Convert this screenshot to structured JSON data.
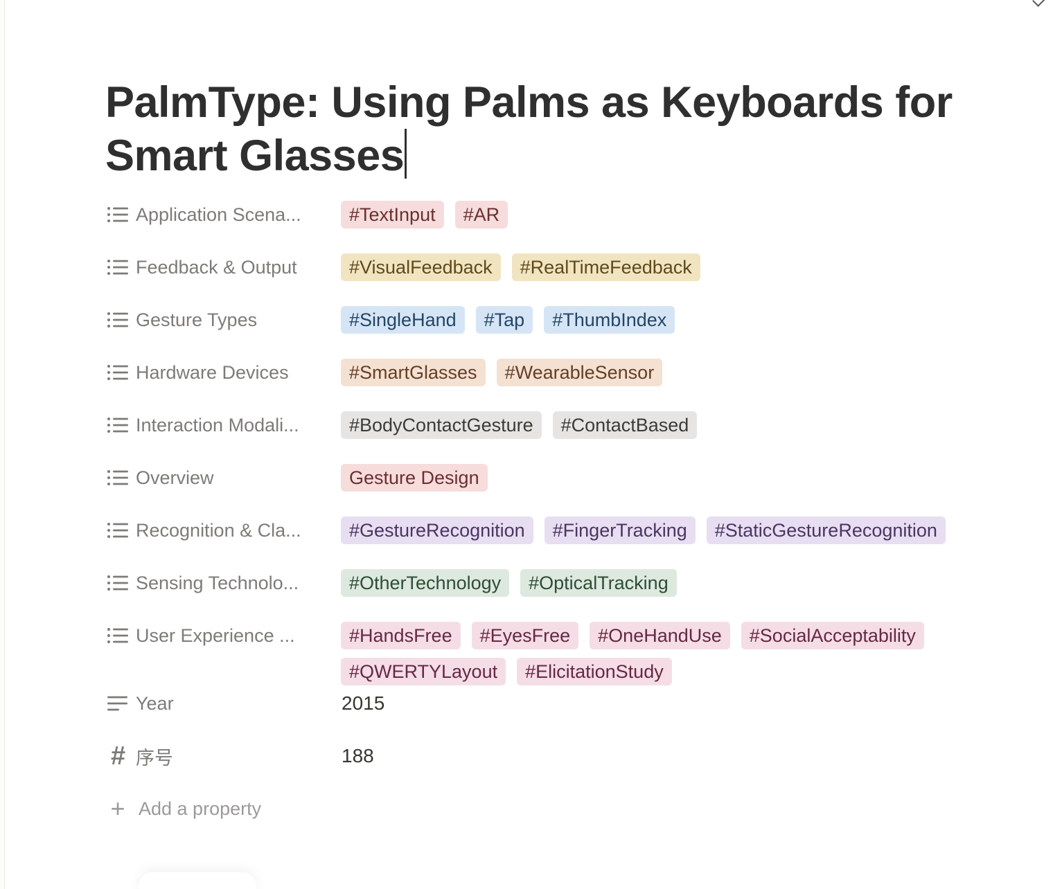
{
  "page": {
    "title": "PalmType: Using Palms as Keyboards for Smart Glasses"
  },
  "properties": [
    {
      "label": "Application Scena...",
      "icon": "list-icon",
      "tags": [
        "#TextInput",
        "#AR"
      ],
      "color": {
        "bg": "#f6dcdc",
        "fg": "#6b2f2f"
      }
    },
    {
      "label": "Feedback & Output",
      "icon": "list-icon",
      "tags": [
        "#VisualFeedback",
        "#RealTimeFeedback"
      ],
      "color": {
        "bg": "#f1e4c1",
        "fg": "#5e4a1c"
      }
    },
    {
      "label": "Gesture Types",
      "icon": "list-icon",
      "tags": [
        "#SingleHand",
        "#Tap",
        "#ThumbIndex"
      ],
      "color": {
        "bg": "#d6e5f5",
        "fg": "#244566"
      }
    },
    {
      "label": "Hardware Devices",
      "icon": "list-icon",
      "tags": [
        "#SmartGlasses",
        "#WearableSensor"
      ],
      "color": {
        "bg": "#f4e1d2",
        "fg": "#633f25"
      }
    },
    {
      "label": "Interaction Modali...",
      "icon": "list-icon",
      "tags": [
        "#BodyContactGesture",
        "#ContactBased"
      ],
      "color": {
        "bg": "#e6e5e3",
        "fg": "#3d3b37"
      }
    },
    {
      "label": "Overview",
      "icon": "list-icon",
      "tags": [
        "Gesture Design"
      ],
      "color": {
        "bg": "#f7dcdc",
        "fg": "#6b2f2f"
      }
    },
    {
      "label": "Recognition & Cla...",
      "icon": "list-icon",
      "tags": [
        "#GestureRecognition",
        "#FingerTracking",
        "#StaticGestureRecognition"
      ],
      "color": {
        "bg": "#e7def1",
        "fg": "#4a3563"
      }
    },
    {
      "label": "Sensing Technolo...",
      "icon": "list-icon",
      "tags": [
        "#OtherTechnology",
        "#OpticalTracking"
      ],
      "color": {
        "bg": "#dde9df",
        "fg": "#2f4d35"
      }
    },
    {
      "label": "User Experience ...",
      "icon": "list-icon",
      "tags": [
        "#HandsFree",
        "#EyesFree",
        "#OneHandUse",
        "#SocialAcceptability",
        "#QWERTYLayout",
        "#ElicitationStudy"
      ],
      "color": {
        "bg": "#f5dde6",
        "fg": "#65293f"
      }
    },
    {
      "label": "Year",
      "icon": "text-lines-icon",
      "text": "2015"
    },
    {
      "label": "序号",
      "icon": "hash-icon",
      "text": "188"
    }
  ],
  "add_property": {
    "icon": "plus-icon",
    "label": "Add a property"
  }
}
